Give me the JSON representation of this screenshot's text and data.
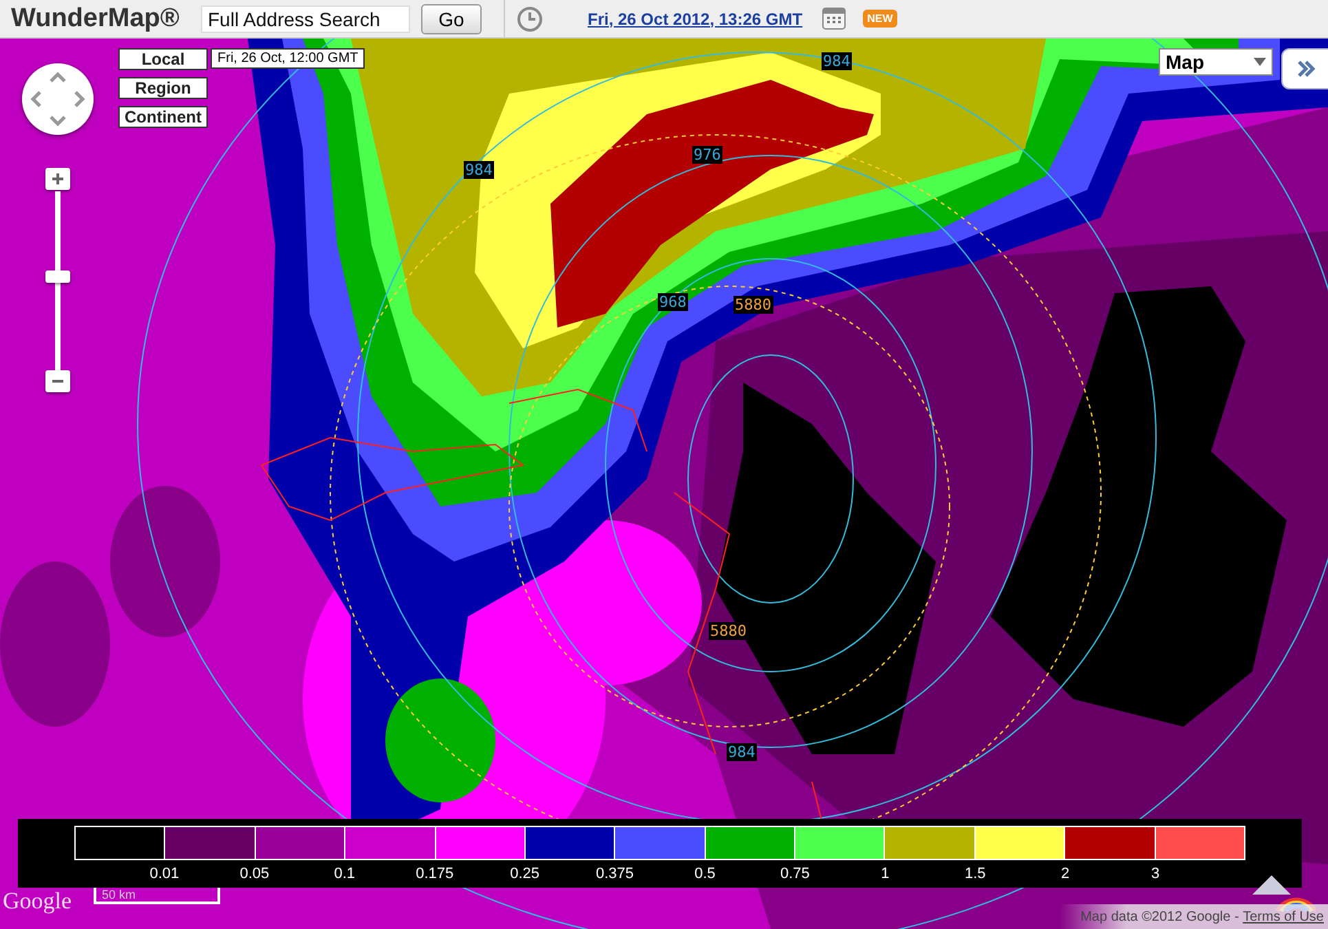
{
  "header": {
    "title": "WunderMap®",
    "search": {
      "value": "Full Address Search"
    },
    "go_button": "Go",
    "date_link": "Fri, 26 Oct 2012, 13:26 GMT",
    "badge": "NEW"
  },
  "map": {
    "view_buttons": [
      {
        "label": "Local"
      },
      {
        "label": "Region"
      },
      {
        "label": "Continent"
      }
    ],
    "time_label": "Fri, 26 Oct, 12:00 GMT",
    "map_type": "Map",
    "zoom": {
      "level": 0.52
    },
    "contour_labels": [
      {
        "text": "984",
        "kind": "pressure"
      },
      {
        "text": "984",
        "kind": "pressure"
      },
      {
        "text": "976",
        "kind": "pressure"
      },
      {
        "text": "968",
        "kind": "pressure"
      },
      {
        "text": "5880",
        "kind": "height"
      },
      {
        "text": "5880",
        "kind": "height"
      },
      {
        "text": "984",
        "kind": "pressure"
      }
    ],
    "legend": {
      "swatches": [
        {
          "color": "#000000"
        },
        {
          "color": "#660066"
        },
        {
          "color": "#990099"
        },
        {
          "color": "#cc00cc"
        },
        {
          "color": "#ff00ff"
        },
        {
          "color": "#0000aa"
        },
        {
          "color": "#4c4cff"
        },
        {
          "color": "#00b000"
        },
        {
          "color": "#4cff4c"
        },
        {
          "color": "#b3b300"
        },
        {
          "color": "#ffff4c"
        },
        {
          "color": "#b30000"
        },
        {
          "color": "#ff4c4c"
        }
      ],
      "labels": [
        "0.01",
        "0.05",
        "0.1",
        "0.175",
        "0.25",
        "0.375",
        "0.5",
        "0.75",
        "1",
        "1.5",
        "2",
        "3"
      ]
    },
    "logo": "Google",
    "scale": "50 km",
    "attribution": "Map data ©2012 Google - ",
    "terms_link": "Terms of Use"
  }
}
